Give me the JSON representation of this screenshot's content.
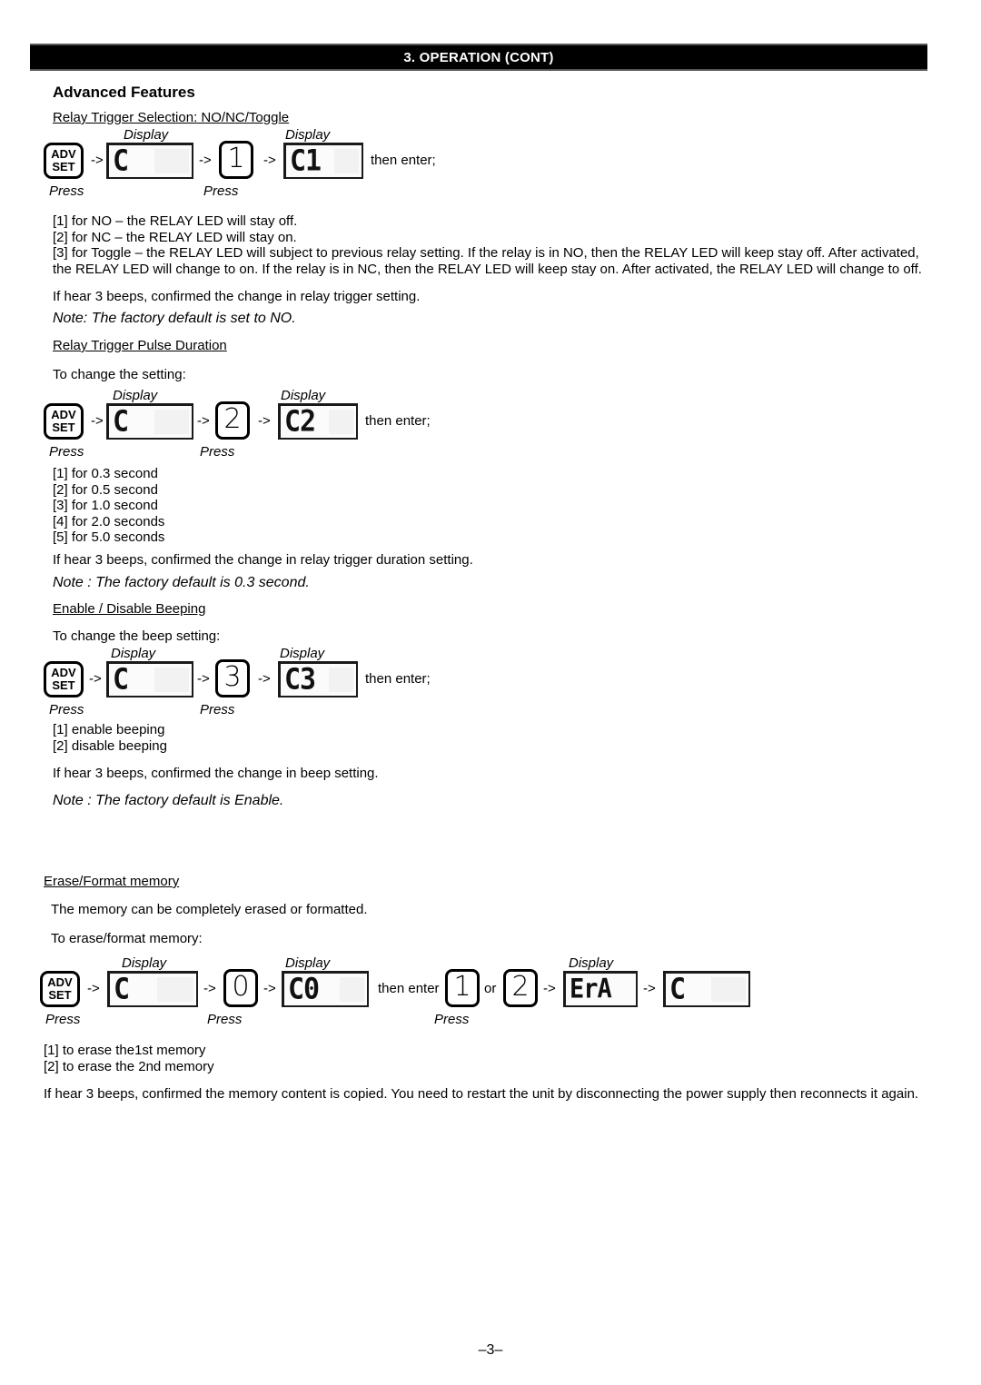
{
  "header": {
    "title": "3. OPERATION (CONT)"
  },
  "page": {
    "section_title": "Advanced Features",
    "page_number": "–3–"
  },
  "keys": {
    "adv": "ADV",
    "set": "SET",
    "press": "Press",
    "display": "Display",
    "arrow": "->",
    "then_enter": "then enter;",
    "then_enter_plain": "then enter",
    "or": "or",
    "num_0": "0",
    "num_1": "1",
    "num_2": "2",
    "num_3": "3"
  },
  "sections": [
    {
      "id": "relay-trigger-selection",
      "heading": "Relay Trigger Selection: NO/NC/Toggle",
      "diagram": {
        "lcd1": "C",
        "key": "1",
        "lcd2": "C1",
        "tail": "then enter;"
      },
      "options": "[1] for NO – the RELAY LED will stay off.\n[2] for NC – the RELAY LED will stay on.",
      "paragraph": "[3] for Toggle – the RELAY LED will subject to previous relay setting. If the relay is in NO, then the RELAY LED will keep stay off. After activated, the RELAY LED will change to on. If the relay is in NC, then the RELAY LED will keep stay on. After activated, the RELAY LED will change to off.",
      "confirm": "If hear 3 beeps, confirmed the change in relay trigger setting.",
      "note": "Note: The factory default is set to NO."
    },
    {
      "id": "relay-trigger-pulse-duration",
      "heading": "Relay Trigger Pulse Duration",
      "intro": "To change the setting:",
      "diagram": {
        "lcd1": "C",
        "key": "2",
        "lcd2": "C2",
        "tail": "then enter;"
      },
      "options": "[1] for 0.3 second\n[2] for 0.5 second\n[3] for 1.0 second\n[4] for 2.0 seconds\n[5] for 5.0 seconds",
      "confirm": "If hear 3 beeps, confirmed the change in relay trigger duration setting.",
      "note": "Note : The factory default is 0.3 second."
    },
    {
      "id": "enable-disable-beeping",
      "heading": "Enable / Disable Beeping",
      "intro": "To change the beep setting:",
      "diagram": {
        "lcd1": "C",
        "key": "3",
        "lcd2": "C3",
        "tail": "then enter;"
      },
      "options": "[1] enable beeping\n[2] disable beeping",
      "confirm": "If hear 3 beeps, confirmed the change in beep setting.",
      "note": "Note : The factory default is Enable."
    },
    {
      "id": "erase-format-memory",
      "heading": "Erase/Format memory",
      "intro1": "The memory can be completely erased or formatted.",
      "intro2": "To erase/format memory:",
      "diagram": {
        "lcd1": "C",
        "key0": "0",
        "lcd2": "C0",
        "then_enter": "then enter",
        "key1": "1",
        "or": "or",
        "key2": "2",
        "lcd3": "ErA",
        "lcd4": "C"
      },
      "options": "[1] to erase the1st memory\n[2] to erase the 2nd memory",
      "confirm": "If hear 3 beeps, confirmed the memory content is copied. You need to restart the unit by disconnecting the power supply then reconnects it again."
    }
  ]
}
